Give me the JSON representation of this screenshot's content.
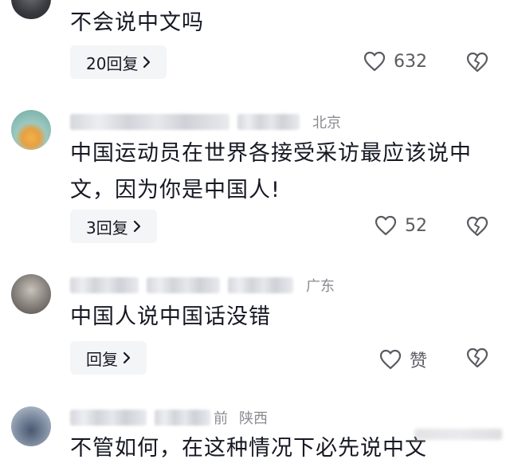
{
  "colors": {
    "text": "#161823",
    "meta": "#8a8b91",
    "reply_bg": "#f4f5f7",
    "icon": "#5a5b61"
  },
  "comments": [
    {
      "author": "",
      "location": "",
      "text": "不会说中文吗",
      "reply_label": "20回复",
      "likes": "632"
    },
    {
      "author": "",
      "location": "北京",
      "text": "中国运动员在世界各接受采访最应该说中文，因为你是中国人!",
      "reply_label": "3回复",
      "likes": "52"
    },
    {
      "author": "",
      "location": "广东",
      "text": "中国人说中国话没错",
      "reply_label": "回复",
      "likes": "赞"
    },
    {
      "author": "",
      "time_suffix": "前",
      "location": "陕西",
      "text": "不管如何，在这种情况下必先说中文"
    }
  ],
  "icons": {
    "like": "heart-icon",
    "dislike": "broken-heart-icon",
    "chevron": "chevron-right-icon"
  }
}
